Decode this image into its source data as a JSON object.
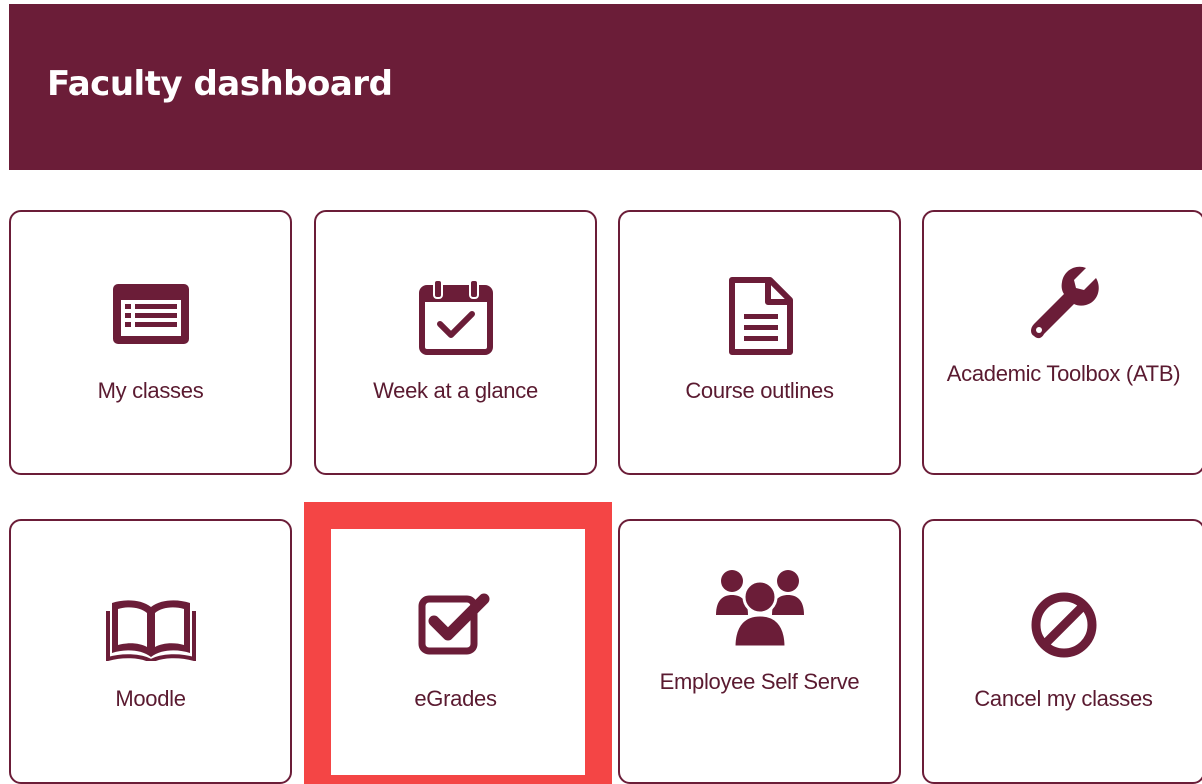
{
  "header": {
    "title": "Faculty dashboard",
    "background": "#6b1d38"
  },
  "tiles": [
    {
      "label": "My classes",
      "icon": "list-icon"
    },
    {
      "label": "Week at a glance",
      "icon": "calendar-check-icon"
    },
    {
      "label": "Course outlines",
      "icon": "document-icon"
    },
    {
      "label": "Academic Toolbox (ATB)",
      "icon": "wrench-icon"
    },
    {
      "label": "Moodle",
      "icon": "open-book-icon"
    },
    {
      "label": "eGrades",
      "icon": "checkbox-icon"
    },
    {
      "label": "Employee Self Serve",
      "icon": "users-group-icon"
    },
    {
      "label": "Cancel my classes",
      "icon": "ban-icon"
    }
  ],
  "highlight_color": "#f44545"
}
